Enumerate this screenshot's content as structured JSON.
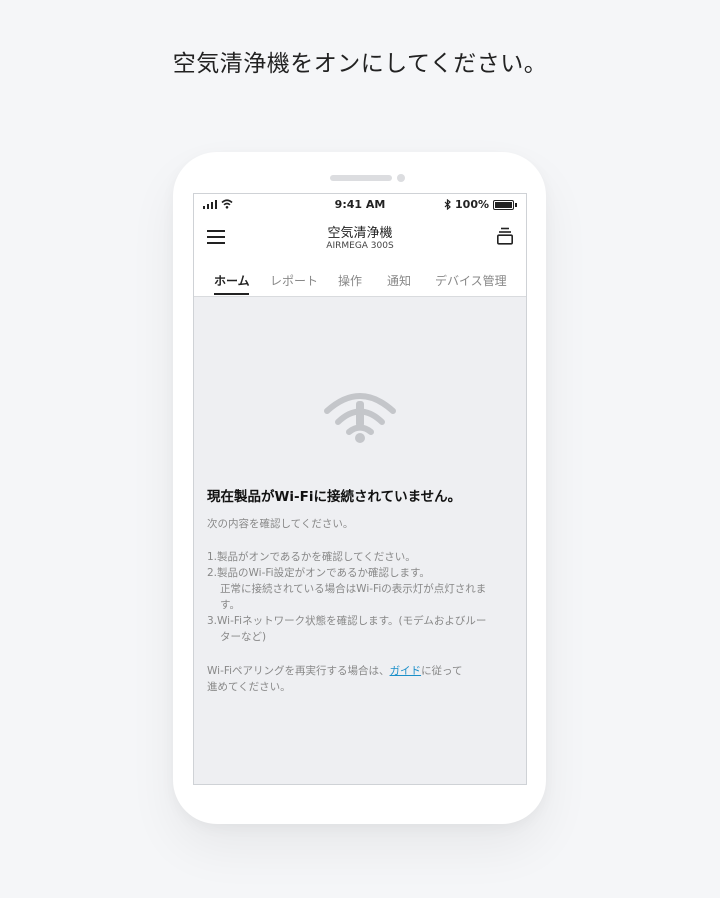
{
  "page": {
    "heading": "空気清浄機をオンにしてください。"
  },
  "status_bar": {
    "time": "9:41 AM",
    "battery": "100%"
  },
  "header": {
    "title": "空気清浄機",
    "subtitle": "AIRMEGA 300S"
  },
  "tabs": [
    {
      "label": "ホーム",
      "active": true
    },
    {
      "label": "レポート",
      "active": false
    },
    {
      "label": "操作",
      "active": false
    },
    {
      "label": "通知",
      "active": false
    },
    {
      "label": "デバイス管理",
      "active": false
    }
  ],
  "error": {
    "title": "現在製品がWi-Fiに接続されていません。",
    "intro": "次の内容を確認してください。",
    "step1": "1.製品がオンであるかを確認してください。",
    "step2": "2.製品のWi-Fi設定がオンであるか確認します。",
    "step2_note_a": "正常に接続されている場合はWi-Fiの表示灯が点灯されま",
    "step2_note_b": "す。",
    "step3_a": "3.Wi-Fiネットワーク状態を確認します。(モデムおよびルー",
    "step3_b": "ターなど)",
    "pairing_prefix": "Wi-Fiペアリングを再実行する場合は、",
    "pairing_link": "ガイド",
    "pairing_suffix": "に従って",
    "pairing_line2": "進めてください。"
  },
  "colors": {
    "accent_link": "#1b8fc9",
    "content_bg": "#eeeff2",
    "icon_gray": "#c4c6ca"
  },
  "icons": {
    "menu": "hamburger-icon",
    "device": "stacked-device-icon",
    "wifi_error": "wifi-exclamation-icon"
  }
}
